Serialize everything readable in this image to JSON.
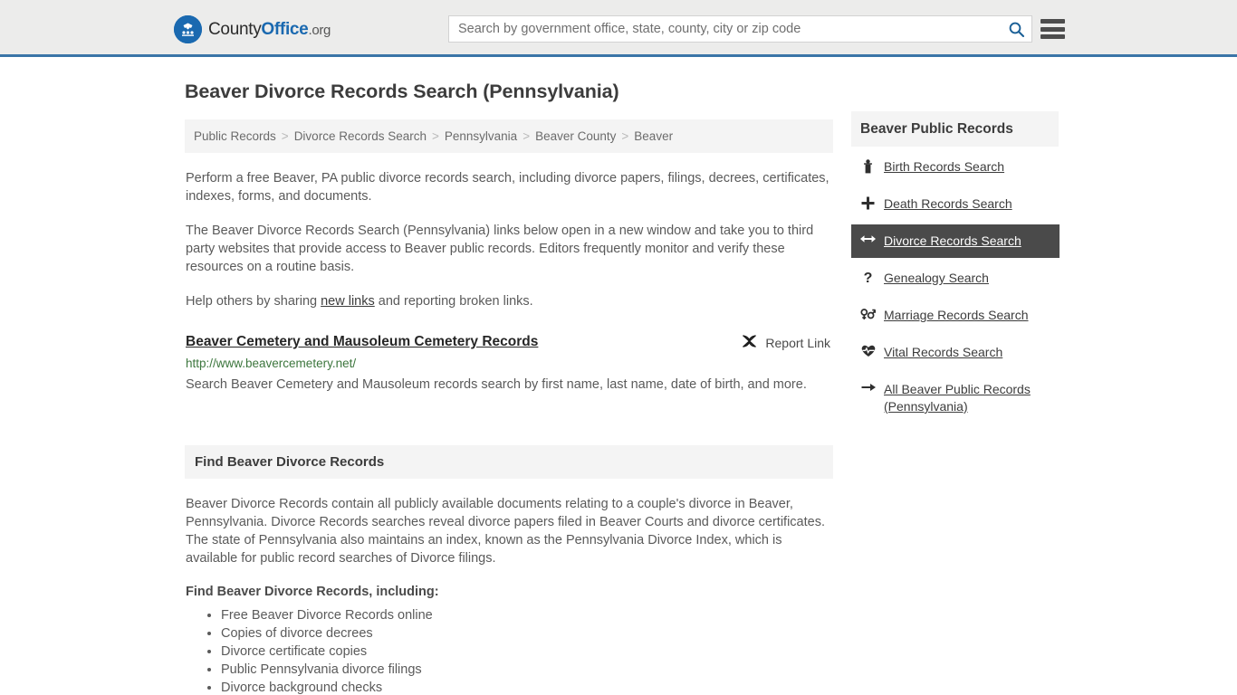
{
  "header": {
    "logo": {
      "icon": "eagle-seal-icon",
      "text_county": "County",
      "text_office": "Office",
      "text_org": ".org"
    },
    "search": {
      "placeholder": "Search by government office, state, county, city or zip code",
      "value": "",
      "search_icon": "search-icon"
    },
    "menu_icon": "hamburger-menu-icon",
    "accent_color": "#3a74a7",
    "background_color": "#ececeb"
  },
  "main": {
    "page_title": "Beaver Divorce Records Search (Pennsylvania)",
    "breadcrumb": [
      "Public Records",
      "Divorce Records Search",
      "Pennsylvania",
      "Beaver County",
      "Beaver"
    ],
    "breadcrumb_separator": ">",
    "paragraphs": {
      "p1": "Perform a free Beaver, PA public divorce records search, including divorce papers, filings, decrees, certificates, indexes, forms, and documents.",
      "p2": "The Beaver Divorce Records Search (Pennsylvania) links below open in a new window and take you to third party websites that provide access to Beaver public records. Editors frequently monitor and verify these resources on a routine basis.",
      "p3_before": "Help others by sharing ",
      "p3_link": "new links",
      "p3_after": " and reporting broken links."
    },
    "results": [
      {
        "title": "Beaver Cemetery and Mausoleum Cemetery Records",
        "url": "http://www.beavercemetery.net/",
        "description": "Search Beaver Cemetery and Mausoleum records search by first name, last name, date of birth, and more.",
        "report_label": "Report Link",
        "report_icon": "broken-link-icon",
        "url_color": "#3c763d"
      }
    ],
    "section": {
      "heading": "Find Beaver Divorce Records",
      "body": "Beaver Divorce Records contain all publicly available documents relating to a couple's divorce in Beaver, Pennsylvania. Divorce Records searches reveal divorce papers filed in Beaver Courts and divorce certificates. The state of Pennsylvania also maintains an index, known as the Pennsylvania Divorce Index, which is available for public record searches of Divorce filings.",
      "list_heading": "Find Beaver Divorce Records, including:",
      "list_items": [
        "Free Beaver Divorce Records online",
        "Copies of divorce decrees",
        "Divorce certificate copies",
        "Public Pennsylvania divorce filings",
        "Divorce background checks"
      ]
    }
  },
  "sidebar": {
    "heading": "Beaver Public Records",
    "active_color": "#4a4a4a",
    "items": [
      {
        "label": "Birth Records Search",
        "icon": "baby-icon",
        "active": false
      },
      {
        "label": "Death Records Search",
        "icon": "cross-icon",
        "active": false
      },
      {
        "label": "Divorce Records Search",
        "icon": "left-right-arrow-icon",
        "active": true
      },
      {
        "label": "Genealogy Search",
        "icon": "question-mark-icon",
        "active": false
      },
      {
        "label": "Marriage Records Search",
        "icon": "venus-mars-icon",
        "active": false
      },
      {
        "label": "Vital Records Search",
        "icon": "heartbeat-icon",
        "active": false
      },
      {
        "label": "All Beaver Public Records (Pennsylvania)",
        "icon": "arrow-right-icon",
        "active": false
      }
    ]
  }
}
